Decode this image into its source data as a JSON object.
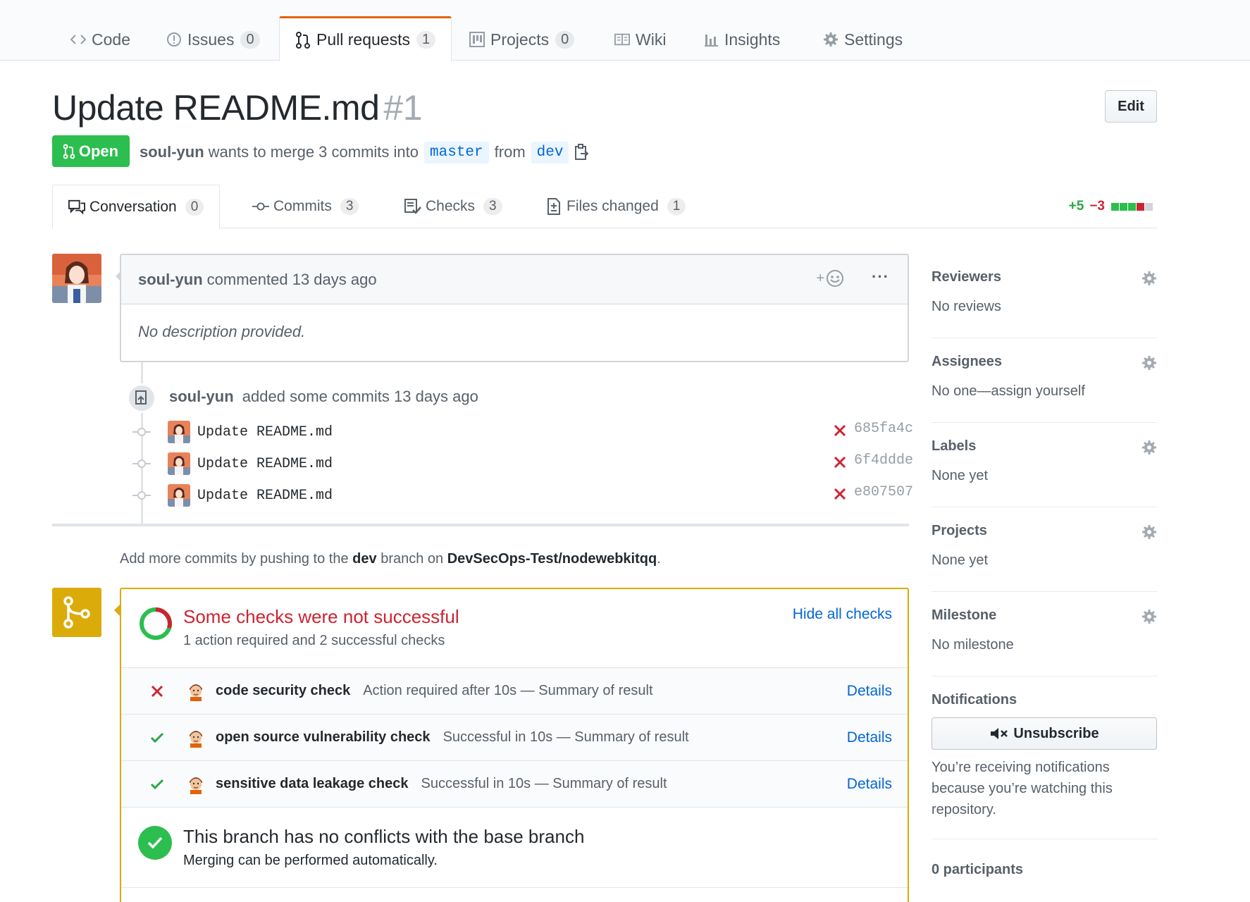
{
  "repo_nav": {
    "tabs": [
      {
        "label": "Code",
        "icon": "code-icon",
        "counter": null
      },
      {
        "label": "Issues",
        "icon": "issue-icon",
        "counter": "0"
      },
      {
        "label": "Pull requests",
        "icon": "pull-request-icon",
        "counter": "1",
        "selected": true
      },
      {
        "label": "Projects",
        "icon": "project-icon",
        "counter": "0"
      },
      {
        "label": "Wiki",
        "icon": "book-icon",
        "counter": null
      },
      {
        "label": "Insights",
        "icon": "graph-icon",
        "counter": null
      },
      {
        "label": "Settings",
        "icon": "gear-icon",
        "counter": null
      }
    ]
  },
  "pr": {
    "title": "Update README.md",
    "number": "#1",
    "edit_label": "Edit",
    "state": "Open",
    "author": "soul-yun",
    "meta_text": "wants to merge 3 commits into",
    "base_branch": "master",
    "from_text": "from",
    "head_branch": "dev"
  },
  "pr_tabs": [
    {
      "label": "Conversation",
      "icon": "comment-discussion-icon",
      "counter": "0",
      "selected": true
    },
    {
      "label": "Commits",
      "icon": "git-commit-icon",
      "counter": "3"
    },
    {
      "label": "Checks",
      "icon": "checklist-icon",
      "counter": "3"
    },
    {
      "label": "Files changed",
      "icon": "file-diff-icon",
      "counter": "1"
    }
  ],
  "diffstat": {
    "additions": "+5",
    "deletions": "−3",
    "blocks": [
      "add",
      "add",
      "add",
      "del",
      "neutral"
    ]
  },
  "comment": {
    "author": "soul-yun",
    "action": "commented 13 days ago",
    "body": "No description provided."
  },
  "commits_event": {
    "author": "soul-yun",
    "action": "added some commits 13 days ago",
    "commits": [
      {
        "message": "Update README.md",
        "sha": "685fa4c",
        "status": "failure"
      },
      {
        "message": "Update README.md",
        "sha": "6f4ddde",
        "status": "failure"
      },
      {
        "message": "Update README.md",
        "sha": "e807507",
        "status": "failure"
      }
    ]
  },
  "push_hint": {
    "prefix": "Add more commits by pushing to the",
    "branch": "dev",
    "middle": "branch on",
    "repo": "DevSecOps-Test/nodewebkitqq",
    "suffix": "."
  },
  "merge_box": {
    "title": "Some checks were not successful",
    "subtitle": "1 action required and 2 successful checks",
    "hide_label": "Hide all checks",
    "checks": [
      {
        "status": "failure",
        "name": "code security check",
        "description": "Action required after 10s — Summary of result",
        "details": "Details"
      },
      {
        "status": "success",
        "name": "open source vulnerability check",
        "description": "Successful in 10s — Summary of result",
        "details": "Details"
      },
      {
        "status": "success",
        "name": "sensitive data leakage check",
        "description": "Successful in 10s — Summary of result",
        "details": "Details"
      }
    ],
    "no_conflicts_title": "This branch has no conflicts with the base branch",
    "no_conflicts_sub": "Merging can be performed automatically."
  },
  "sidebar": {
    "sections": [
      {
        "label": "Reviewers",
        "value": "No reviews"
      },
      {
        "label": "Assignees",
        "value": "No one—assign yourself"
      },
      {
        "label": "Labels",
        "value": "None yet"
      },
      {
        "label": "Projects",
        "value": "None yet"
      },
      {
        "label": "Milestone",
        "value": "No milestone"
      }
    ],
    "notifications_label": "Notifications",
    "unsubscribe_label": "Unsubscribe",
    "notifications_text": "You’re receiving notifications because you’re watching this repository.",
    "participants": "0 participants"
  },
  "colors": {
    "accent": "#0366d6",
    "open_green": "#2cbe4e",
    "failure_red": "#cb2431",
    "pending_yellow": "#dbab0a",
    "tab_orange": "#e36209"
  }
}
